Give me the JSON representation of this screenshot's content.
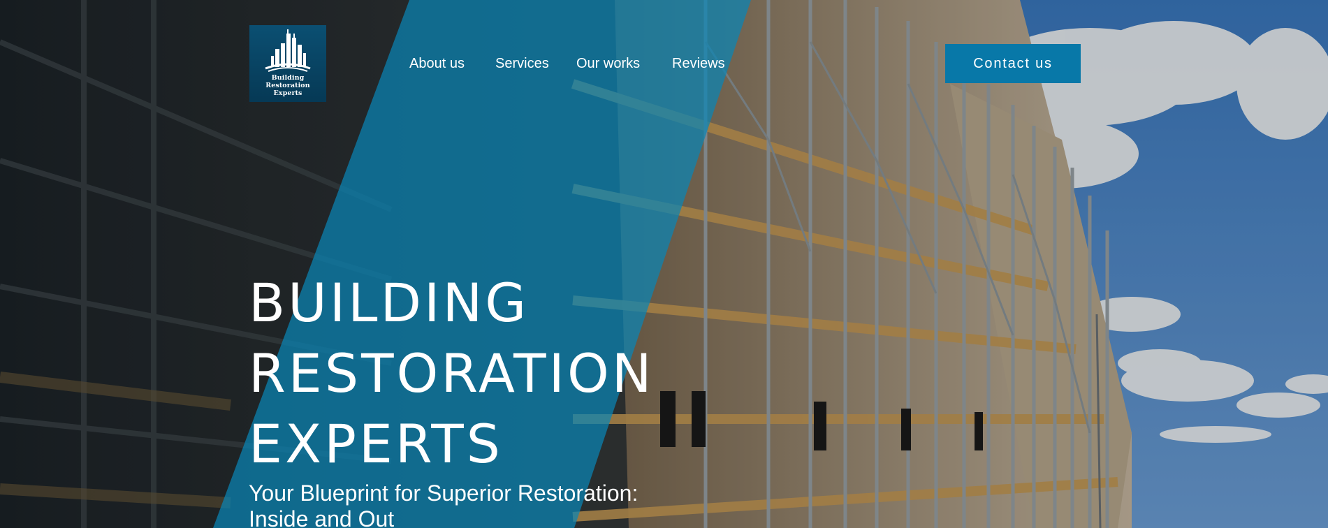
{
  "brand": {
    "logo_line1": "Building Restoration",
    "logo_line2": "Experts"
  },
  "nav": {
    "items": [
      {
        "label": "About us"
      },
      {
        "label": "Services"
      },
      {
        "label": "Our works"
      },
      {
        "label": "Reviews"
      }
    ]
  },
  "cta": {
    "contact_label": "Contact us"
  },
  "hero": {
    "headline_line1": "BUILDING",
    "headline_line2": "RESTORATION",
    "headline_line3": "EXPERTS",
    "tagline_line1": "Your Blueprint for Superior Restoration:",
    "tagline_line2": "Inside and Out"
  },
  "colors": {
    "accent": "#0878a8",
    "panel_overlay": "#0a7fae",
    "logo_bg": "#0b4f72",
    "sky": "#4a86c8",
    "text": "#ffffff"
  },
  "icons": {
    "logo_mark": "city-buildings-icon"
  }
}
